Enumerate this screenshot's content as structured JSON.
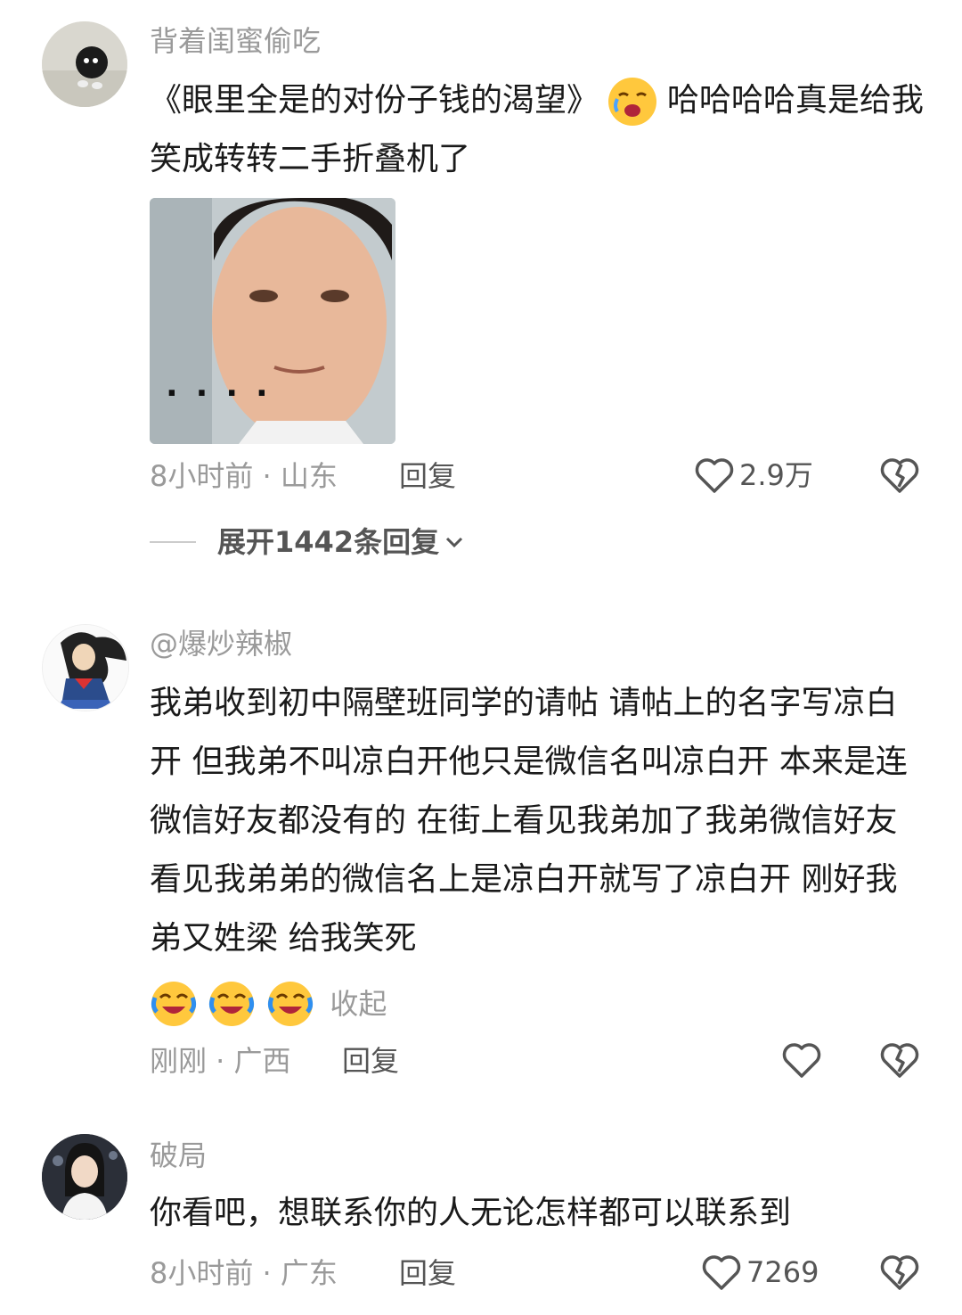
{
  "comments": [
    {
      "username": "背着闺蜜偷吃",
      "text_before_emoji": "《眼里全是的对份子钱的渴望》",
      "text_after_emoji": "哈哈哈哈真是给我笑成转转二手折叠机了",
      "time_location": "8小时前 · 山东",
      "reply_label": "回复",
      "like_count": "2.9万",
      "expand_label": "展开1442条回复",
      "image_caption": "...."
    },
    {
      "username": "@爆炒辣椒",
      "text": "我弟收到初中隔壁班同学的请帖 请帖上的名字写凉白开  但我弟不叫凉白开他只是微信名叫凉白开   本来是连微信好友都没有的 在街上看见我弟加了我弟微信好友  看见我弟弟的微信名上是凉白开就写了凉白开 刚好我弟又姓梁     给我笑死",
      "collapse_label": "收起",
      "time_location": "刚刚 · 广西",
      "reply_label": "回复"
    },
    {
      "username": "破局",
      "text": "你看吧，想联系你的人无论怎样都可以联系到",
      "time_location": "8小时前 · 广东",
      "reply_label": "回复",
      "like_count": "7269"
    }
  ],
  "icons": {
    "like": "heart-outline-icon",
    "dislike": "broken-heart-icon",
    "expand": "chevron-down-icon"
  },
  "colors": {
    "meta_gray": "#9a9a9a",
    "emoji_yellow": "#ffc83d"
  }
}
